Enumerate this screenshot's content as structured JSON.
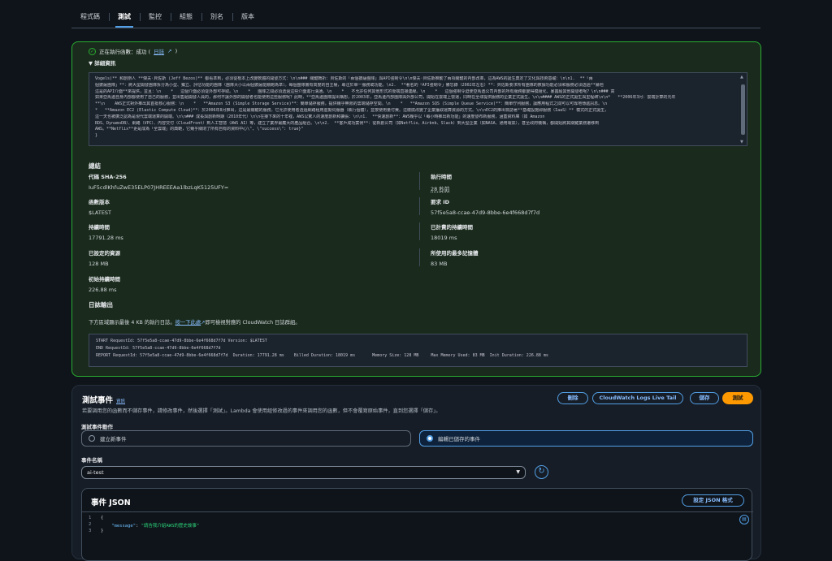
{
  "tabs": [
    "程式碼",
    "測試",
    "監控",
    "組態",
    "別名",
    "版本"
  ],
  "exec": {
    "status": "正在執行函數：成功 (",
    "log_link": "日誌",
    "status_end": ")",
    "details_label": "詳細資訊"
  },
  "response_lines": [
    "Vogels)** 和創辦人 **傑夫·貝佐斯 (Jeff Bezos)** 都看準到，必須從根本上改變軟體的開發方式：\\n\\n### 關鍵轉折：貝佐斯的「兩個披薩團隊」與API強制令\\n\\n傑夫·貝佐斯推動了兩項關鍵的內部改革，這為AWS的誕生奠定了文化與技術基礎：\\n\\n1.  **「兩",
    "個披薩團隊」**：將大型開發團隊拆分為小型、獨立、評估功能的團隊（團隊大小以兩個披薩能餵飽為準）。每個團隊擁有高度的自主權，專注於單一服務或功能。\\n2.  **著名的「API強制令」備忘錄（2002年左右）**：貝佐斯要求所有團隊的數據功能必須和服務必須透過**暴他",
    "這是的API介面**來提供，並且：\\n    *   這個介面必須從外部可存取。\\n    *   團隊之間必須透過這些介面進行溝通。\\n    *   不允許任何其他形式的後端直接連線。\\n    *   這個強制令迫使亞馬遜公司內部的所有服務都變得模組化、暴露給其他開發者呢？\\n\\n### 高",
    "如果亞馬遜自身內部都使用了自己的服務，並出售給開發人員的，那何不讓外部的開發者也能使用這些服務呢？此時，**亞馬遜團隊提出構想，於2003年，亞馬遜內部團隊與外部公司，開始在雲端上營運，同時在全球提供服務的企業正式誕生。\\n\\n#### AWS的正式誕生與里程碑\\n\\n*   **2006年3月：雲端計算的元年",
    "**\\n    AWS正式對外推出其首批核心服務：\\n    *   **Amazon S3 (Simple Storage Service)**：簡單儲存服務，提供幾乎無限的雲端儲存空間。\\n    *   **Amazon SQS (Simple Queue Service)**：簡單佇列服務，讓應用程式之間可以可靠地傳遞訊息。\\n",
    "*   **Amazon EC2 (Elastic Compute Cloud)**：於2006年8月推出，這是最關鍵的服務。它允許使用者透過網路租用虛擬伺服器（執行個體），並按使用量付費。這徹底改變了企業獲取運算資源的方式。\\n\\nEC2的推出標誌著**基礎設施即服務（IaaS）** 模式的正式誕生，",
    "這一天也被廣泛認為是現代雲端運算的開端。\\n\\n### 成長與創新時期（2010年代）\\n\\n在接下來的十年裡，AWS以驚人的速度創新和擴張：\\n\\n1.  **快速創新**：AWS幾乎以「每小時推出新功能」的速度發布新服務，涵蓋資料庫（如 Amazon",
    "RDS、DynamoDB）、網路（VPC）、內容交付（CloudFront）到人工智慧（AWS AI）等，建立了業界最龐大的產品組合。\\n\\n2.  **客戶成功案例**：從新創公司（如Netflix、Airbnb、Slack）到大型企業（如NASA、通用電氣），甚至政府機構，都開始將其關鍵業務遷移到",
    "AWS。**Netflix**更是成為「全雲端」的典範，它幾乎關閉了所有自有的資料中心\\\", \\\"success\\\": true}\"",
    "}"
  ],
  "summary": {
    "title": "總結",
    "code_sha_label": "代碼 SHA-256",
    "code_sha": "IuF5cdlKhfuZwE35ELP07JHREEEAa1lbzLqK5125UFY=",
    "exec_time_label": "執行時間",
    "exec_time": "28 秒前",
    "version_label": "函數版本",
    "version": "$LATEST",
    "request_id_label": "要求 ID",
    "request_id": "57f5e5a8-ccae-47d9-8bbe-6e4f668d7f7d",
    "duration_label": "持續時間",
    "duration": "17791.28 ms",
    "billed_label": "已計費的持續時間",
    "billed": "18019 ms",
    "resources_label": "已設定的資源",
    "resources": "128 MB",
    "maxmem_label": "所使用的最多記憶體",
    "maxmem": "83 MB",
    "init_label": "初始持續時間",
    "init": "226.88 ms"
  },
  "log": {
    "title": "日誌輸出",
    "hint_pre": "下方區域顯示最後 4 KB 的執行日誌。",
    "hint_link": "按一下此處",
    "hint_post": "即可檢視對應的 CloudWatch 日誌群組。",
    "lines": [
      "START RequestId: 57f5e5a8-ccae-47d9-8bbe-6e4f668d7f7d Version: $LATEST",
      "END RequestId: 57f5e5a8-ccae-47d9-8bbe-6e4f668d7f7d",
      "REPORT RequestId: 57f5e5a8-ccae-47d9-8bbe-6e4f668d7f7d  Duration: 17791.28 ms    Billed Duration: 18019 ms       Memory Size: 128 MB     Max Memory Used: 83 MB  Init Duration: 226.88 ms"
    ]
  },
  "test": {
    "title": "測試事件",
    "info": "資訊",
    "desc": "若要調用您的函數而不儲存事件，請修改事件，然後選擇「測試」。Lambda 會使用經修改過的事件來調用您的函數，但不會覆寫原始事件，直到您選擇「儲存」。",
    "delete": "刪除",
    "live_tail": "CloudWatch Logs Live Tail",
    "save": "儲存",
    "test": "測試",
    "action_label": "測試事件動作",
    "opt_new": "建立新事件",
    "opt_edit": "編輯已儲存的事件",
    "name_label": "事件名稱",
    "name_value": "ai-test",
    "json_title": "事件 JSON",
    "format_btn": "設定 JSON 格式",
    "json_lines": [
      "{",
      "    \"message\": \"請告我介紹AWS的歷史故事\"",
      "}"
    ],
    "json_key": "\"message\"",
    "json_val": "\"請告我介紹AWS的歷史故事\""
  },
  "colors": {
    "success": "#29ad32",
    "accent": "#539fe5",
    "primary": "#ff9900"
  }
}
